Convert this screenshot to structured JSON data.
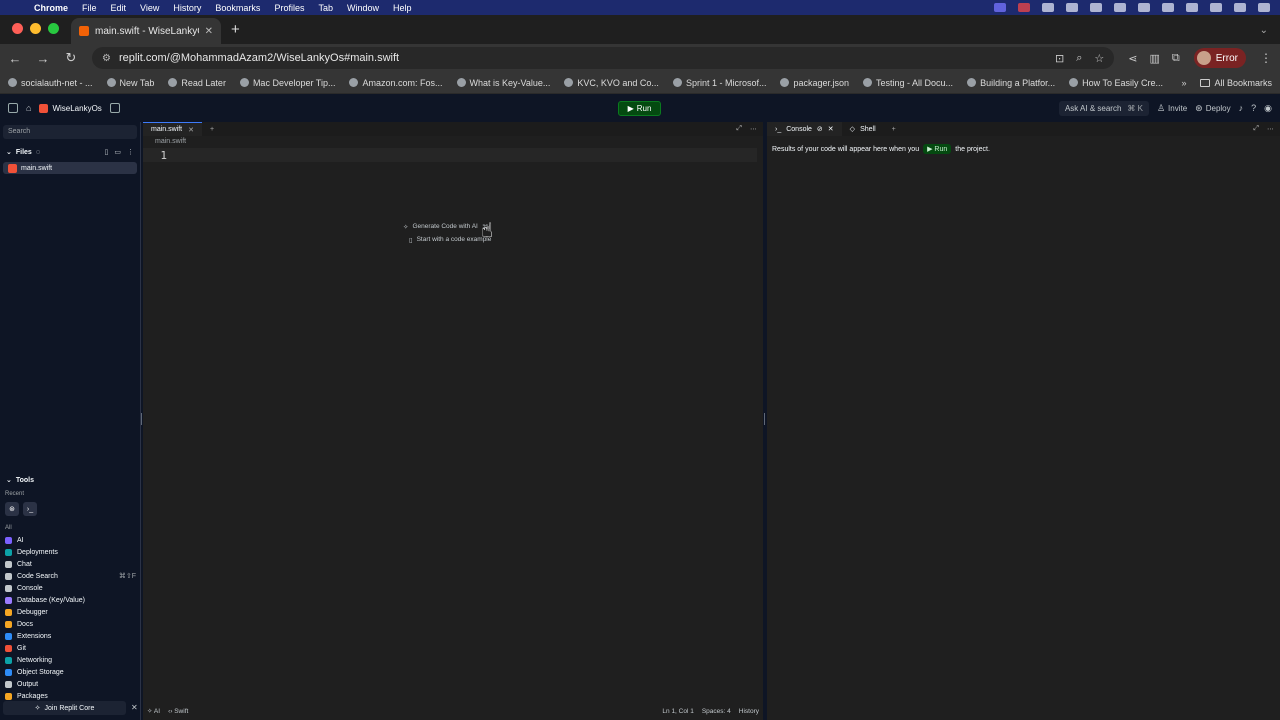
{
  "menubar": {
    "app": "Chrome",
    "items": [
      "File",
      "Edit",
      "View",
      "History",
      "Bookmarks",
      "Profiles",
      "Tab",
      "Window",
      "Help"
    ]
  },
  "browser": {
    "tab_title": "main.swift - WiseLankyOs - R",
    "url": "replit.com/@MohammadAzam2/WiseLankyOs#main.swift",
    "profile_label": "Error",
    "bookmarks": [
      "socialauth-net - ...",
      "New Tab",
      "Read Later",
      "Mac Developer Tip...",
      "Amazon.com: Fos...",
      "What is Key-Value...",
      "KVC, KVO and Co...",
      "Sprint 1 - Microsof...",
      "packager.json",
      "Testing - All Docu...",
      "Building a Platfor...",
      "How To Easily Cre..."
    ],
    "all_bookmarks": "All Bookmarks"
  },
  "replit_header": {
    "repl_name": "WiseLankyOs",
    "run_label": "Run",
    "search_label": "Ask AI & search",
    "search_kbd": "⌘ K",
    "invite_label": "Invite",
    "deploy_label": "Deploy"
  },
  "sidebar": {
    "search_placeholder": "Search",
    "files_label": "Files",
    "files": [
      "main.swift"
    ],
    "tools_label": "Tools",
    "recent_label": "Recent",
    "all_label": "All",
    "tools": [
      {
        "label": "AI",
        "color": "#7b61ff",
        "kbd": ""
      },
      {
        "label": "Deployments",
        "color": "#0ca2a8",
        "kbd": ""
      },
      {
        "label": "Chat",
        "color": "#c2c8cc",
        "kbd": ""
      },
      {
        "label": "Code Search",
        "color": "#c2c8cc",
        "kbd": "⌘⇧F"
      },
      {
        "label": "Console",
        "color": "#c2c8cc",
        "kbd": ""
      },
      {
        "label": "Database (Key/Value)",
        "color": "#9a7bff",
        "kbd": ""
      },
      {
        "label": "Debugger",
        "color": "#f5a623",
        "kbd": ""
      },
      {
        "label": "Docs",
        "color": "#f5a623",
        "kbd": ""
      },
      {
        "label": "Extensions",
        "color": "#2e8cf7",
        "kbd": ""
      },
      {
        "label": "Git",
        "color": "#f05138",
        "kbd": ""
      },
      {
        "label": "Networking",
        "color": "#0ca2a8",
        "kbd": ""
      },
      {
        "label": "Object Storage",
        "color": "#2e8cf7",
        "kbd": ""
      },
      {
        "label": "Output",
        "color": "#c2c8cc",
        "kbd": ""
      },
      {
        "label": "Packages",
        "color": "#f5a623",
        "kbd": ""
      }
    ],
    "join_label": "Join Replit Core"
  },
  "editor": {
    "tab_label": "main.swift",
    "breadcrumb": "main.swift",
    "line_number": "1",
    "generate_label": "Generate Code with AI",
    "generate_kbd": "⌘I",
    "example_label": "Start with a code example",
    "status_ai": "AI",
    "status_lang": "Swift",
    "status_pos": "Ln 1, Col 1",
    "status_spaces": "Spaces: 4",
    "status_history": "History"
  },
  "console": {
    "tab_console": "Console",
    "tab_shell": "Shell",
    "results_before": "Results of your code will appear here when you",
    "run_label": "Run",
    "results_after": "the project."
  }
}
